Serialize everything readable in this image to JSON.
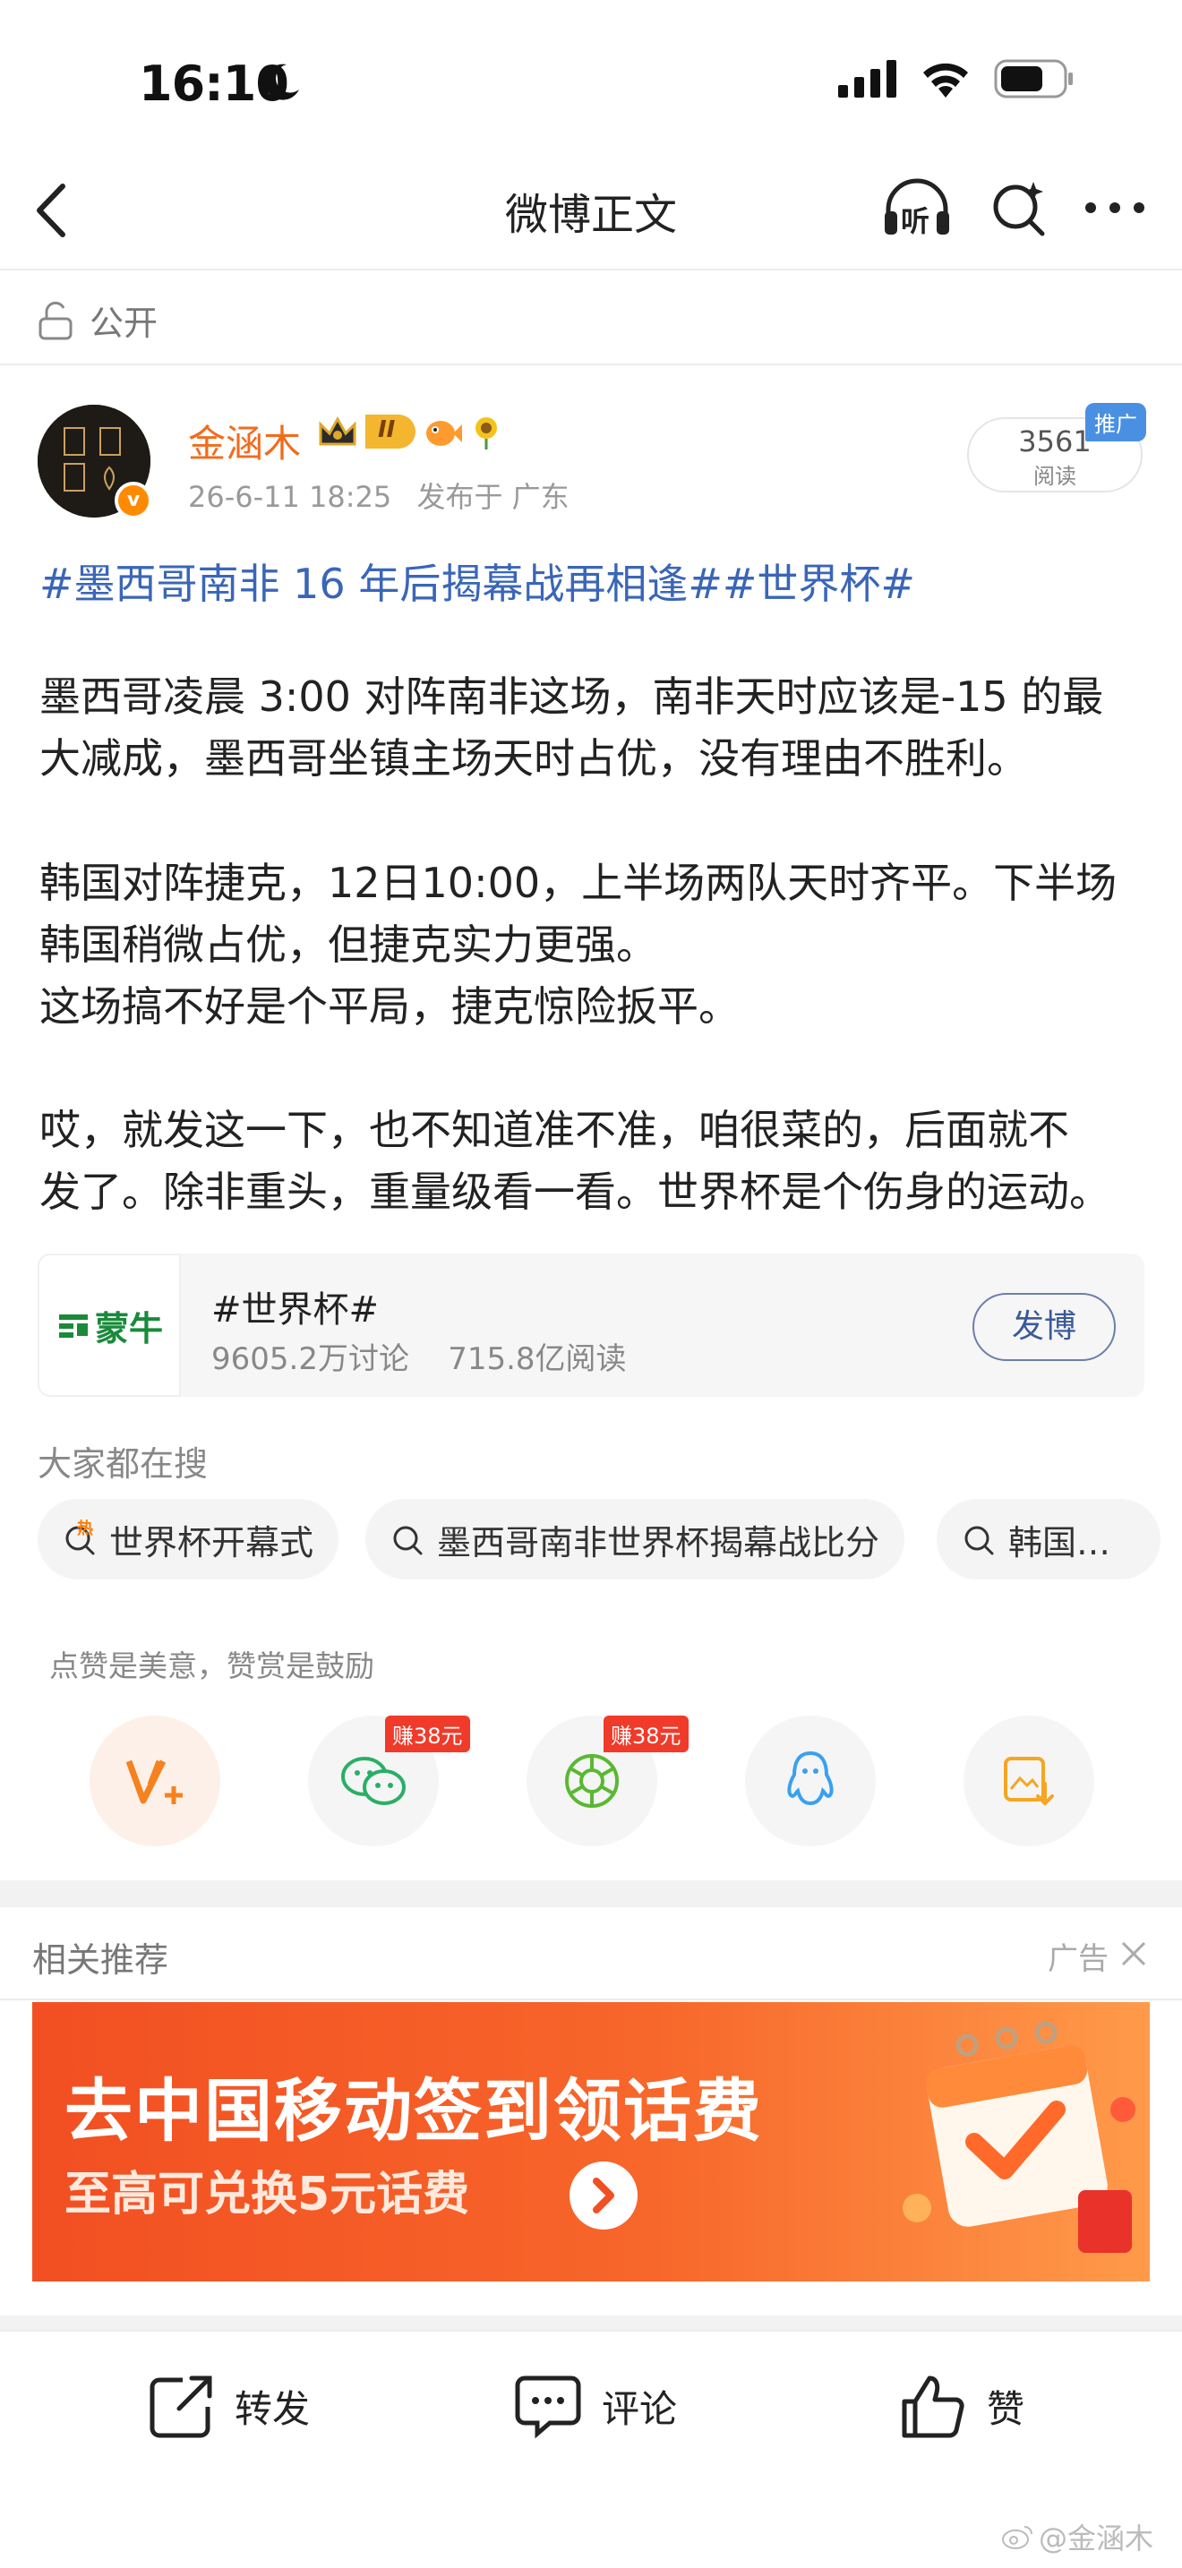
{
  "status_bar": {
    "time": "16:10"
  },
  "nav": {
    "title": "微博正文",
    "listen_label": "听"
  },
  "visibility": {
    "label": "公开"
  },
  "author": {
    "name": "金涵木",
    "level_badge": "II",
    "timestamp": "26-6-11 18:25",
    "source": "发布于 广东",
    "verified_mark": "v"
  },
  "reads": {
    "count": "3561",
    "label": "阅读",
    "promo_tag": "推广"
  },
  "post": {
    "topic_line": "#墨西哥南非 16 年后揭幕战再相逢##世界杯#",
    "paragraphs": [
      [
        "墨西哥凌晨 3:00 对阵南非这场，南非天时应该是-15 的最",
        "大减成，墨西哥坐镇主场天时占优，没有理由不胜利。"
      ],
      [
        "韩国对阵捷克，12日10:00，上半场两队天时齐平。下半场",
        "韩国稍微占优，但捷克实力更强。",
        "这场搞不好是个平局，捷克惊险扳平。"
      ],
      [
        "哎，就发这一下，也不知道准不准，咱很菜的，后面就不",
        "发了。除非重头，重量级看一看。世界杯是个伤身的运动。"
      ]
    ]
  },
  "topic_card": {
    "logo_text": "蒙牛",
    "title": "#世界杯#",
    "stats": "9605.2万讨论    715.8亿阅读",
    "button": "发博"
  },
  "searches": {
    "heading": "大家都在搜",
    "chips": [
      "世界杯开幕式",
      "墨西哥南非世界杯揭幕战比分",
      "韩国…"
    ],
    "hot_badge": "热"
  },
  "reward": {
    "hint": "点赞是美意，赞赏是鼓励",
    "earn_badges": [
      "赚38元",
      "赚38元"
    ]
  },
  "related": {
    "title": "相关推荐",
    "ad_label": "广告",
    "banner_title": "去中国移动签到领话费",
    "banner_sub": "至高可兑换5元话费"
  },
  "actions": {
    "repost": "转发",
    "comment": "评论",
    "like": "赞"
  },
  "watermark": "@金涵木",
  "colors": {
    "author": "#f26b1d",
    "topic": "#3a66b8",
    "banner": "#f24f22",
    "earn_badge": "#f03a2a",
    "promo_tag": "#4a90e2"
  }
}
